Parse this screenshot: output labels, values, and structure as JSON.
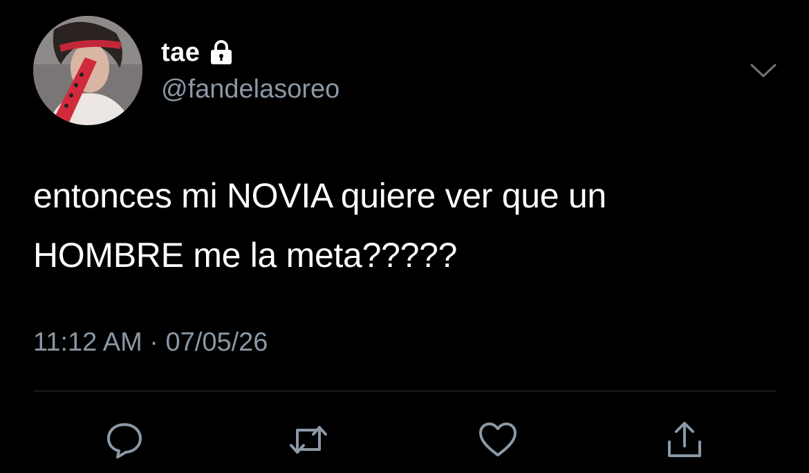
{
  "user": {
    "display_name": "tae",
    "handle": "@fandelasoreo",
    "protected_icon": "lock-icon"
  },
  "tweet": {
    "lines": [
      "entonces mi NOVIA quiere ver que un",
      "HOMBRE me la meta?????"
    ],
    "time": "11:12 AM",
    "separator": "·",
    "date": "07/05/26"
  },
  "actions": [
    {
      "name": "reply",
      "icon": "speech-bubble-icon"
    },
    {
      "name": "retweet",
      "icon": "retweet-arrows-icon"
    },
    {
      "name": "like",
      "icon": "heart-icon"
    },
    {
      "name": "share",
      "icon": "share-upload-icon"
    }
  ],
  "colors": {
    "background": "#000000",
    "text": "#ffffff",
    "secondary": "#8b98a5",
    "divider": "#2f3336",
    "icon": "#8b98a5"
  }
}
